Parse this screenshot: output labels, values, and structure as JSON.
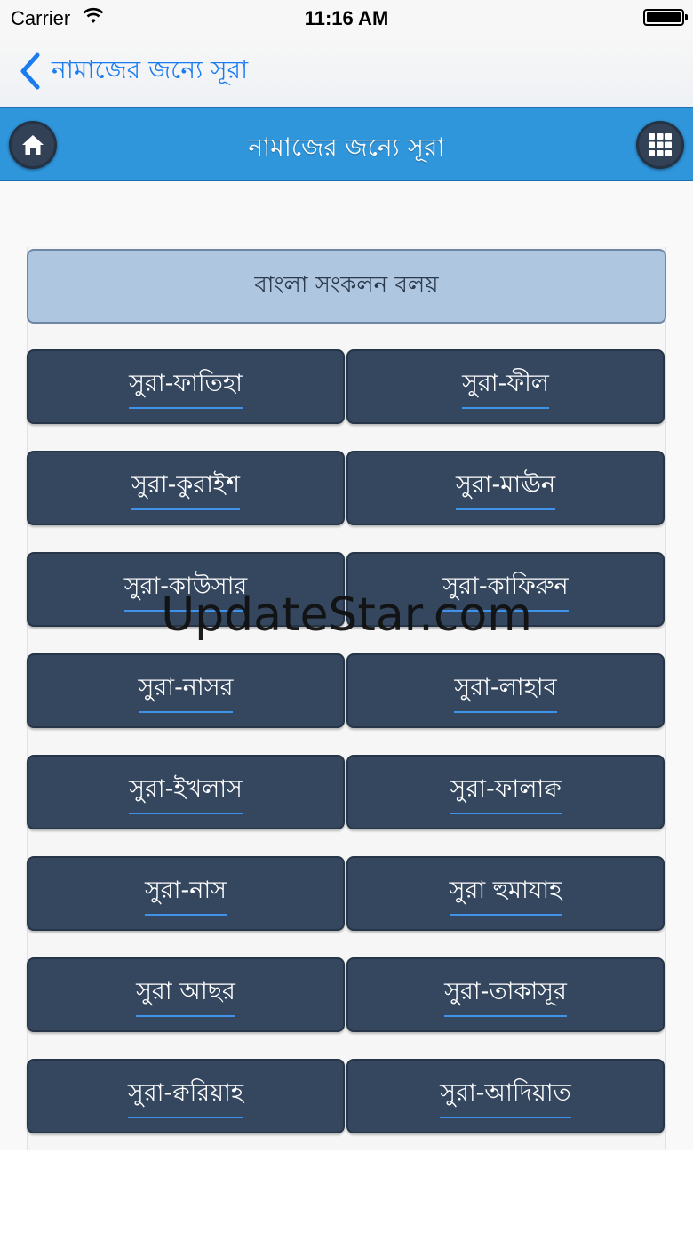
{
  "status_bar": {
    "carrier": "Carrier",
    "time": "11:16 AM"
  },
  "nav": {
    "back_label": "নামাজের জন্যে সূরা"
  },
  "header": {
    "title": "নামাজের জন্যে সূরা",
    "left_icon": "home-icon",
    "right_icon": "grid-menu-icon"
  },
  "banner": {
    "label": "বাংলা সংকলন বলয়"
  },
  "suras": [
    "সুরা-ফাতিহা",
    "সুরা-ফীল",
    "সুরা-কুরাইশ",
    "সুরা-মাঊন",
    "সুরা-কাউসার",
    "সুরা-কাফিরুন",
    "সুরা-নাসর",
    "সুরা-লাহাব",
    "সুরা-ইখলাস",
    "সুরা-ফালাক্ব",
    "সুরা-নাস",
    "সুরা হুমাযাহ",
    "সুরা আছর",
    "সুরা-তাকাসূর",
    "সুরা-ক্বরিয়াহ",
    "সুরা-আদিয়াত"
  ],
  "watermark": "UpdateStar.com",
  "colors": {
    "header": "#2f96dc",
    "button": "#34475f",
    "banner": "#aec6e0",
    "link_blue": "#1a7cf0"
  }
}
